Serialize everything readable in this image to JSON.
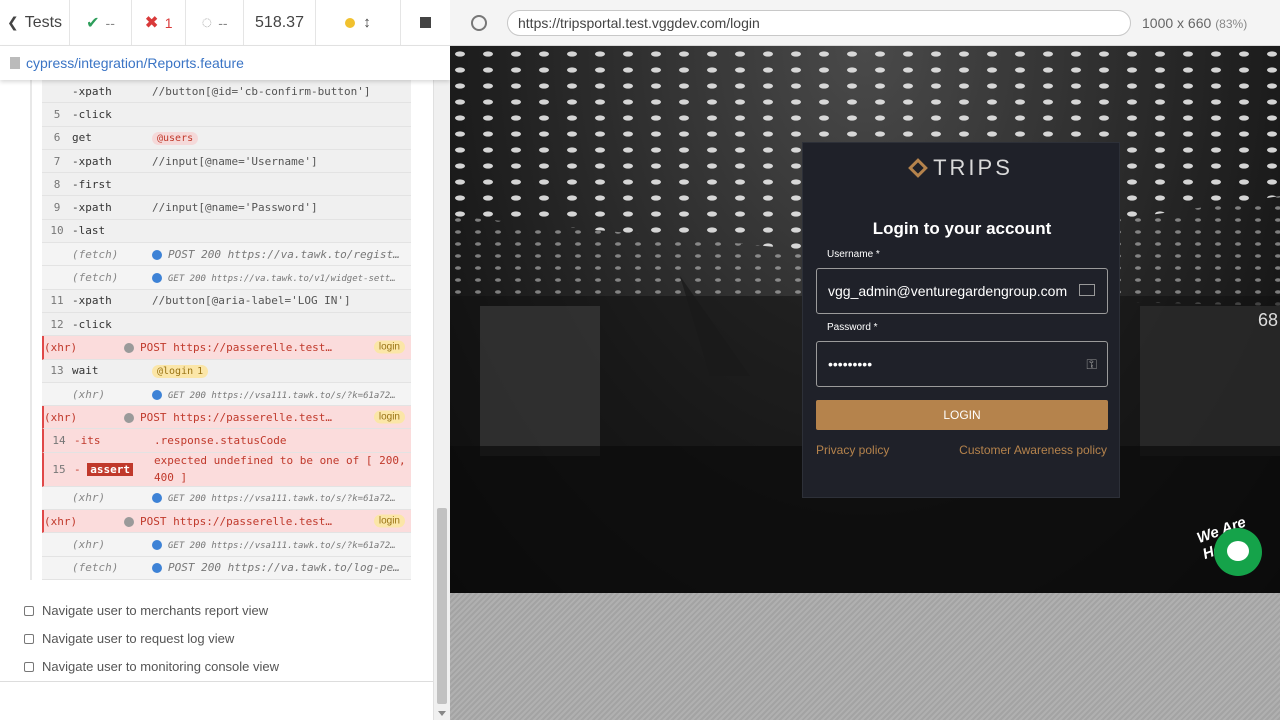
{
  "topbar": {
    "tests_label": "Tests",
    "passed": "--",
    "failed": "1",
    "pending": "--",
    "duration": "518.37"
  },
  "spec": {
    "path": "cypress/integration/Reports.feature"
  },
  "commands": [
    {
      "num": "",
      "name": "-xpath",
      "msg": "//button[@id='cb-confirm-button']",
      "type": "cmd"
    },
    {
      "num": "5",
      "name": "-click",
      "msg": "",
      "type": "cmd"
    },
    {
      "num": "6",
      "name": "get",
      "msg": "",
      "tag": "@users",
      "type": "cmd"
    },
    {
      "num": "7",
      "name": "-xpath",
      "msg": "//input[@name='Username']",
      "type": "cmd"
    },
    {
      "num": "8",
      "name": "-first",
      "msg": "",
      "type": "cmd"
    },
    {
      "num": "9",
      "name": "-xpath",
      "msg": "//input[@name='Password']",
      "type": "cmd"
    },
    {
      "num": "10",
      "name": "-last",
      "msg": "",
      "type": "cmd"
    },
    {
      "num": "",
      "name": "(fetch)",
      "msg": "POST 200 https://va.tawk.to/regist…",
      "type": "ev",
      "dot": "b"
    },
    {
      "num": "",
      "name": "(fetch)",
      "msg": "GET 200 https://va.tawk.to/v1/widget-sett…",
      "type": "ev",
      "dot": "b",
      "small": true
    },
    {
      "num": "11",
      "name": "-xpath",
      "msg": "//button[@aria-label='LOG IN']",
      "type": "cmd"
    },
    {
      "num": "12",
      "name": "-click",
      "msg": "",
      "type": "cmd"
    },
    {
      "num": "",
      "name": "(xhr)",
      "msg": "POST https://passerelle.test…",
      "type": "err",
      "dot": "g",
      "badge": "login"
    },
    {
      "num": "13",
      "name": "wait",
      "msg": "",
      "tag": "@login",
      "tagcount": "1",
      "type": "cmd"
    },
    {
      "num": "",
      "name": "(xhr)",
      "msg": "GET 200 https://vsa111.tawk.to/s/?k=61a72…",
      "type": "ev",
      "dot": "b",
      "small": true
    },
    {
      "num": "",
      "name": "(xhr)",
      "msg": "POST https://passerelle.test…",
      "type": "err",
      "dot": "g",
      "badge": "login"
    },
    {
      "num": "14",
      "name": "-its",
      "msg": ".response.statusCode",
      "type": "errcmd"
    },
    {
      "num": "15",
      "name": "-",
      "assert": "assert",
      "msg": "expected undefined to be one of [ 200, 400 ]",
      "type": "assert"
    },
    {
      "num": "",
      "name": "(xhr)",
      "msg": "GET 200 https://vsa111.tawk.to/s/?k=61a72…",
      "type": "ev",
      "dot": "b",
      "small": true
    },
    {
      "num": "",
      "name": "(xhr)",
      "msg": "POST https://passerelle.test…",
      "type": "err",
      "dot": "g",
      "badge": "login"
    },
    {
      "num": "",
      "name": "(xhr)",
      "msg": "GET 200 https://vsa111.tawk.to/s/?k=61a72…",
      "type": "ev",
      "dot": "b",
      "small": true
    },
    {
      "num": "",
      "name": "(fetch)",
      "msg": "POST 200 https://va.tawk.to/log-pe…",
      "type": "ev",
      "dot": "b"
    }
  ],
  "tests": [
    "Navigate user to merchants report view",
    "Navigate user to request log view",
    "Navigate user to monitoring console view"
  ],
  "browser": {
    "url": "https://tripsportal.test.vggdev.com/login",
    "viewport_size": "1000 x 660",
    "zoom": "(83%)"
  },
  "login": {
    "brand": "TRIPS",
    "heading": "Login to your account",
    "username_label": "Username *",
    "username_value": "vgg_admin@venturegardengroup.com",
    "password_label": "Password *",
    "password_value": "•••••••••",
    "button": "LOGIN",
    "privacy": "Privacy policy",
    "awareness": "Customer Awareness policy"
  },
  "chat": {
    "bubble": "We Are Here!"
  },
  "sign": {
    "number": "68"
  },
  "colors": {
    "accent": "#b5834c",
    "error": "#c0392b",
    "link": "#3a74c5"
  }
}
